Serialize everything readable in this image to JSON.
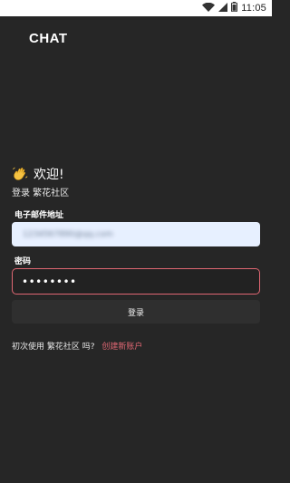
{
  "status_bar": {
    "time": "11:05",
    "icons": [
      "wifi-icon",
      "signal-icon",
      "battery-icon"
    ]
  },
  "brand": {
    "title": "CHAT"
  },
  "welcome": {
    "icon": "waving-hand-icon",
    "title": "欢迎!",
    "subtitle": "登录 繁花社区"
  },
  "form": {
    "email_label": "电子邮件地址",
    "email_value": "1234567890@qq.com",
    "password_label": "密码",
    "password_value": "••••••••",
    "submit_label": "登录"
  },
  "signup": {
    "prompt": "初次使用 繁花社区 吗?",
    "link_label": "创建新账户"
  },
  "colors": {
    "background": "#262626",
    "accent": "#e06773",
    "email_field_bg": "#e7f0ff",
    "button_bg": "#2f2f2f"
  }
}
